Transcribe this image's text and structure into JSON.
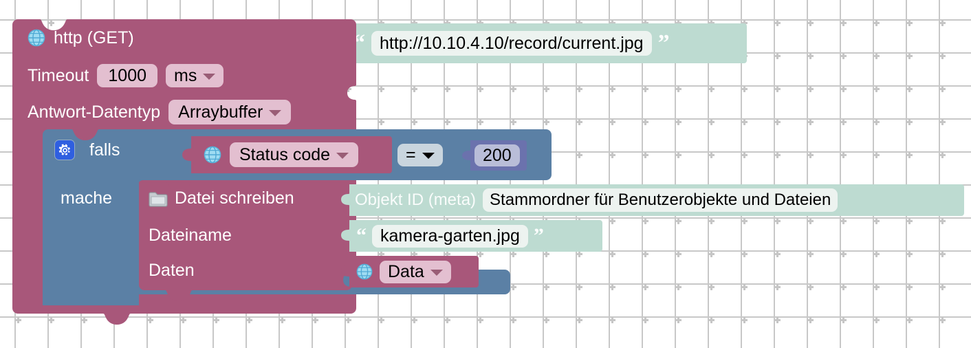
{
  "workspace": {
    "background_color": "#ffffff",
    "grid_color": "#c6c6c6",
    "grid_spacing": 48
  },
  "colors": {
    "http_block": "#a8577a",
    "control_block": "#5b80a5",
    "string_block": "#bddbd1",
    "number_block": "#6b72ad",
    "field_pink": "#e3bfd0",
    "field_pale": "#edf3f0",
    "field_lavender": "#b9bdd8",
    "field_bluegray": "#c9d5de",
    "gear_badge": "#2f5fe0"
  },
  "http_block": {
    "icon": "globe-icon",
    "title": "http (GET)",
    "url_input": {
      "open_quote": "“",
      "close_quote": "”",
      "value": "http://10.10.4.10/record/current.jpg"
    },
    "timeout_label": "Timeout",
    "timeout_value": "1000",
    "timeout_unit": "ms",
    "timeout_unit_caret": "chevron-down-icon",
    "response_type_label": "Antwort-Datentyp",
    "response_type_value": "Arraybuffer",
    "response_type_caret": "chevron-down-icon"
  },
  "if_block": {
    "mutator_icon": "gear-icon",
    "if_label": "falls",
    "do_label": "mache",
    "condition": {
      "left": {
        "icon": "globe-icon",
        "value": "Status code",
        "caret": "chevron-down-icon"
      },
      "operator": "=",
      "operator_caret": "chevron-down-icon",
      "right": {
        "value": "200"
      }
    }
  },
  "file_write_block": {
    "icon": "folder-icon",
    "title": "Datei schreiben",
    "rows": [
      {
        "label": "Objekt ID (meta)",
        "value": "Stammordner für Benutzerobjekte und Dateien"
      },
      {
        "label": "Dateiname",
        "open_quote": "“",
        "close_quote": "”",
        "value": "kamera-garten.jpg"
      },
      {
        "label": "Daten",
        "icon": "globe-icon",
        "value": "Data",
        "caret": "chevron-down-icon"
      }
    ]
  }
}
